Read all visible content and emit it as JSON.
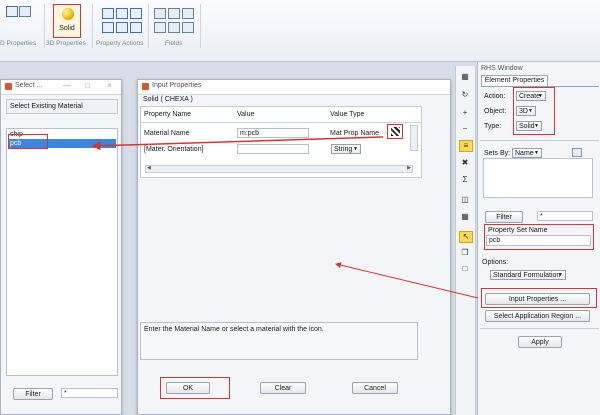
{
  "ribbon": {
    "solid_label": "Solid",
    "group_2d": "D Properties",
    "group_3d": "3D Properties",
    "group_actions": "Property Actions",
    "group_fields": "Fields"
  },
  "select_window": {
    "title": "Select ...",
    "header": "Select Existing Material",
    "items": [
      "chip",
      "pcb"
    ],
    "filter_label": "Filter",
    "filter_value": "*"
  },
  "input_window": {
    "title": "Input Properties",
    "subtitle": "Solid ( CHEXA )",
    "col_name": "Property Name",
    "col_value": "Value",
    "col_type": "Value Type",
    "rows": [
      {
        "name": "Material Name",
        "value": "m:pcb",
        "type": "Mat Prop Name"
      },
      {
        "name": "[Mater. Orientation]",
        "value": "",
        "type": "String"
      }
    ],
    "hint": "Enter the Material Name or select a material with the icon.",
    "ok": "OK",
    "clear": "Clear",
    "cancel": "Cancel"
  },
  "rhs": {
    "title": "RHS Window",
    "tab": "Element Properties",
    "action_label": "Action:",
    "action_value": "Create",
    "object_label": "Object:",
    "object_value": "3D",
    "type_label": "Type:",
    "type_value": "Solid",
    "sets_by_label": "Sets By:",
    "sets_by_value": "Name",
    "filter_label": "Filter",
    "filter_value": "*",
    "pset_label": "Property Set Name",
    "pset_value": "pcb",
    "options_label": "Options:",
    "formulation": "Standard Formulation",
    "input_props_btn": "Input Properties ...",
    "select_region_btn": "Select Application Region ...",
    "apply": "Apply"
  },
  "colors": {
    "annotation": "#e03030",
    "selection": "#3a86e0"
  }
}
